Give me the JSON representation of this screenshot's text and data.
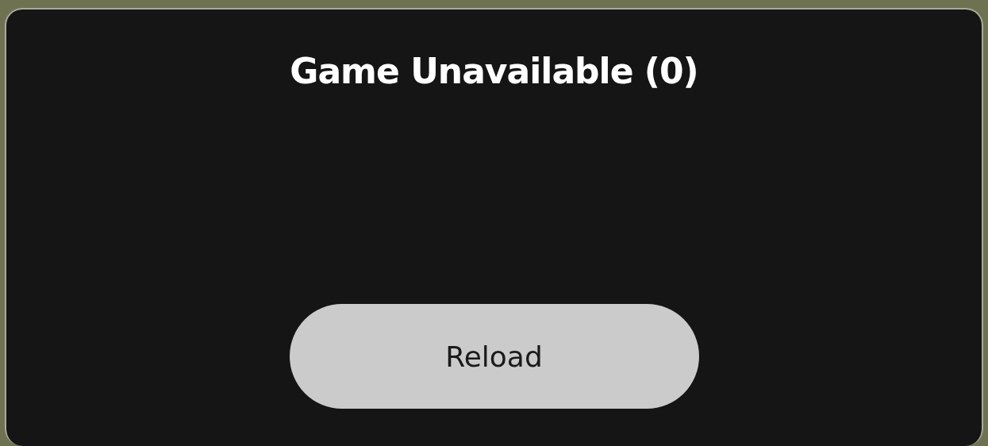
{
  "dialog": {
    "title": "Game Unavailable (0)",
    "button": "Reload"
  }
}
